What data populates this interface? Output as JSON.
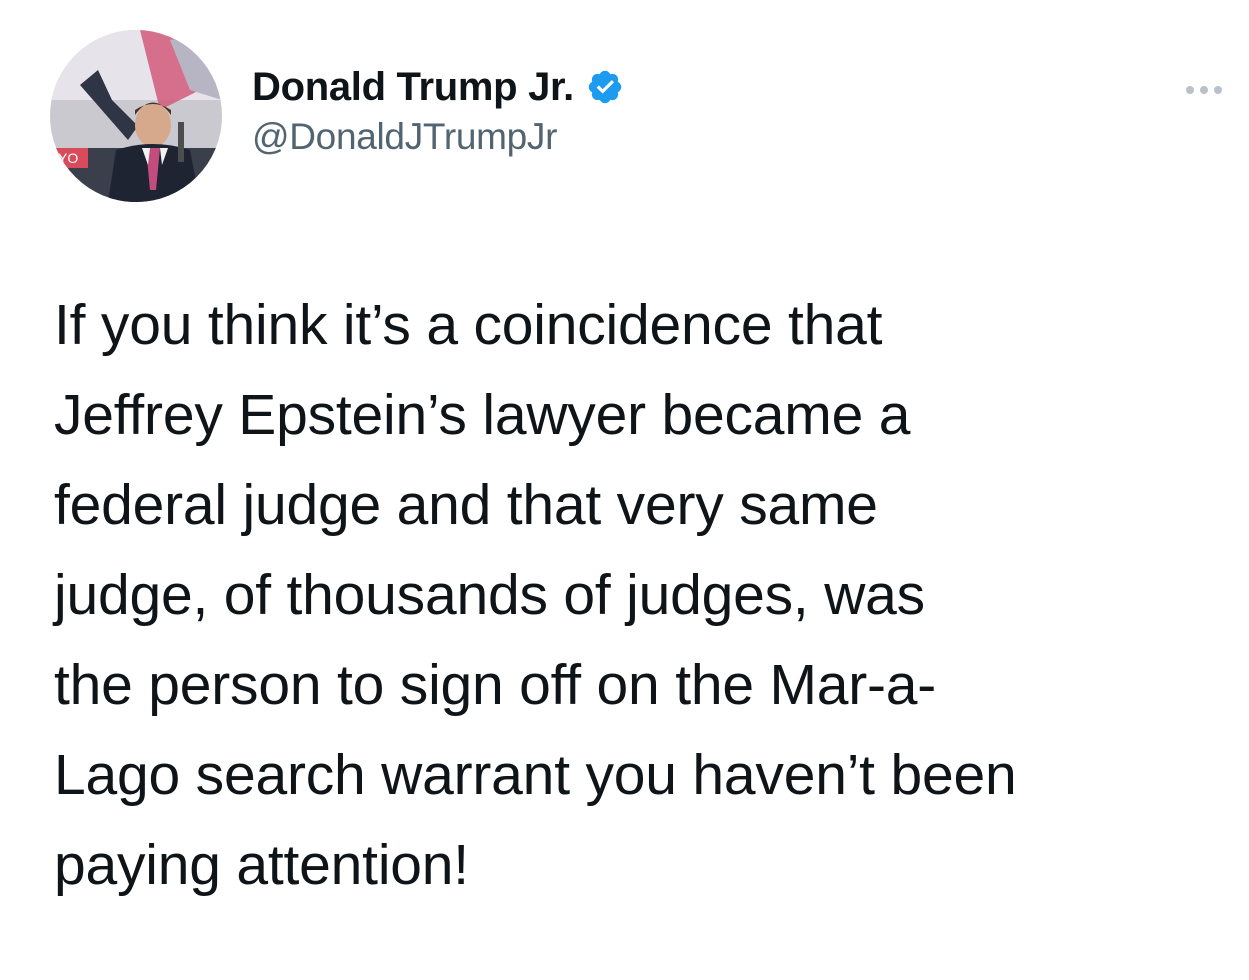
{
  "author": {
    "display_name": "Donald Trump Jr.",
    "handle": "@DonaldJTrumpJr",
    "verified": true,
    "verified_color": "#1d9bf0",
    "avatar_icon": "profile-photo"
  },
  "menu": {
    "icon": "more-options-icon"
  },
  "tweet": {
    "lines": [
      "If you think it’s a coincidence that",
      "Jeffrey Epstein’s lawyer became a",
      "federal judge and that very same",
      "judge, of thousands of judges, was",
      "the person to sign off on the Mar-a-",
      "Lago search warrant you haven’t been",
      "paying attention!"
    ]
  }
}
